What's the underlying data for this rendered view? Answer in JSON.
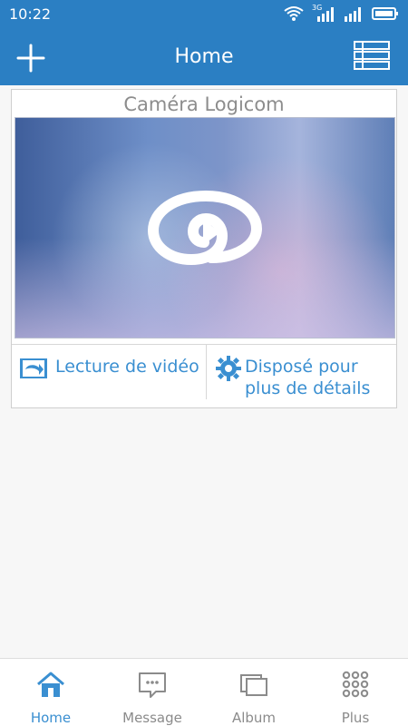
{
  "status_bar": {
    "time": "10:22",
    "network": "3G"
  },
  "header": {
    "title": "Home"
  },
  "camera_card": {
    "name": "Caméra Logicom",
    "actions": {
      "playback": "Lecture de vidéo",
      "settings": "Disposé pour plus de détails"
    }
  },
  "bottom_nav": {
    "items": [
      {
        "label": "Home",
        "active": true
      },
      {
        "label": "Message",
        "active": false
      },
      {
        "label": "Album",
        "active": false
      },
      {
        "label": "Plus",
        "active": false
      }
    ]
  },
  "colors": {
    "primary": "#2b7fc3",
    "accent_text": "#3a8fd1",
    "inactive": "#8b8b8b"
  }
}
